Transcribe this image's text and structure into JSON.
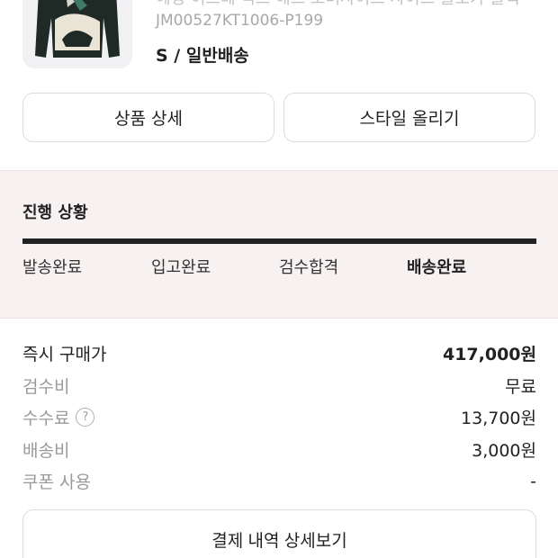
{
  "product": {
    "name": "헤링 이스테 익스 해드 오버사이즈 사이즈 블로카 블랙",
    "code": "JM00527KT1006-P199",
    "option": "S / 일반배송",
    "image_icon": "sweater-image"
  },
  "buttons": {
    "product_detail": "상품 상세",
    "style_upload": "스타일 올리기",
    "receipt_detail": "결제 내역 상세보기"
  },
  "progress": {
    "title": "진행 상황",
    "steps": [
      "발송완료",
      "입고완료",
      "검수합격",
      "배송완료"
    ],
    "current_step": 3,
    "fill": 1.0,
    "bar_color": "#222222",
    "background_color": "#f8f1f1"
  },
  "summary": {
    "rows": [
      {
        "label": "즉시 구매가",
        "value": "417,000원"
      },
      {
        "label": "검수비",
        "value": "무료"
      },
      {
        "label": "수수료",
        "value": "13,700원",
        "icon": "question-circle-icon"
      },
      {
        "label": "배송비",
        "value": "3,000원"
      },
      {
        "label": "쿠폰 사용",
        "value": "-"
      }
    ]
  }
}
